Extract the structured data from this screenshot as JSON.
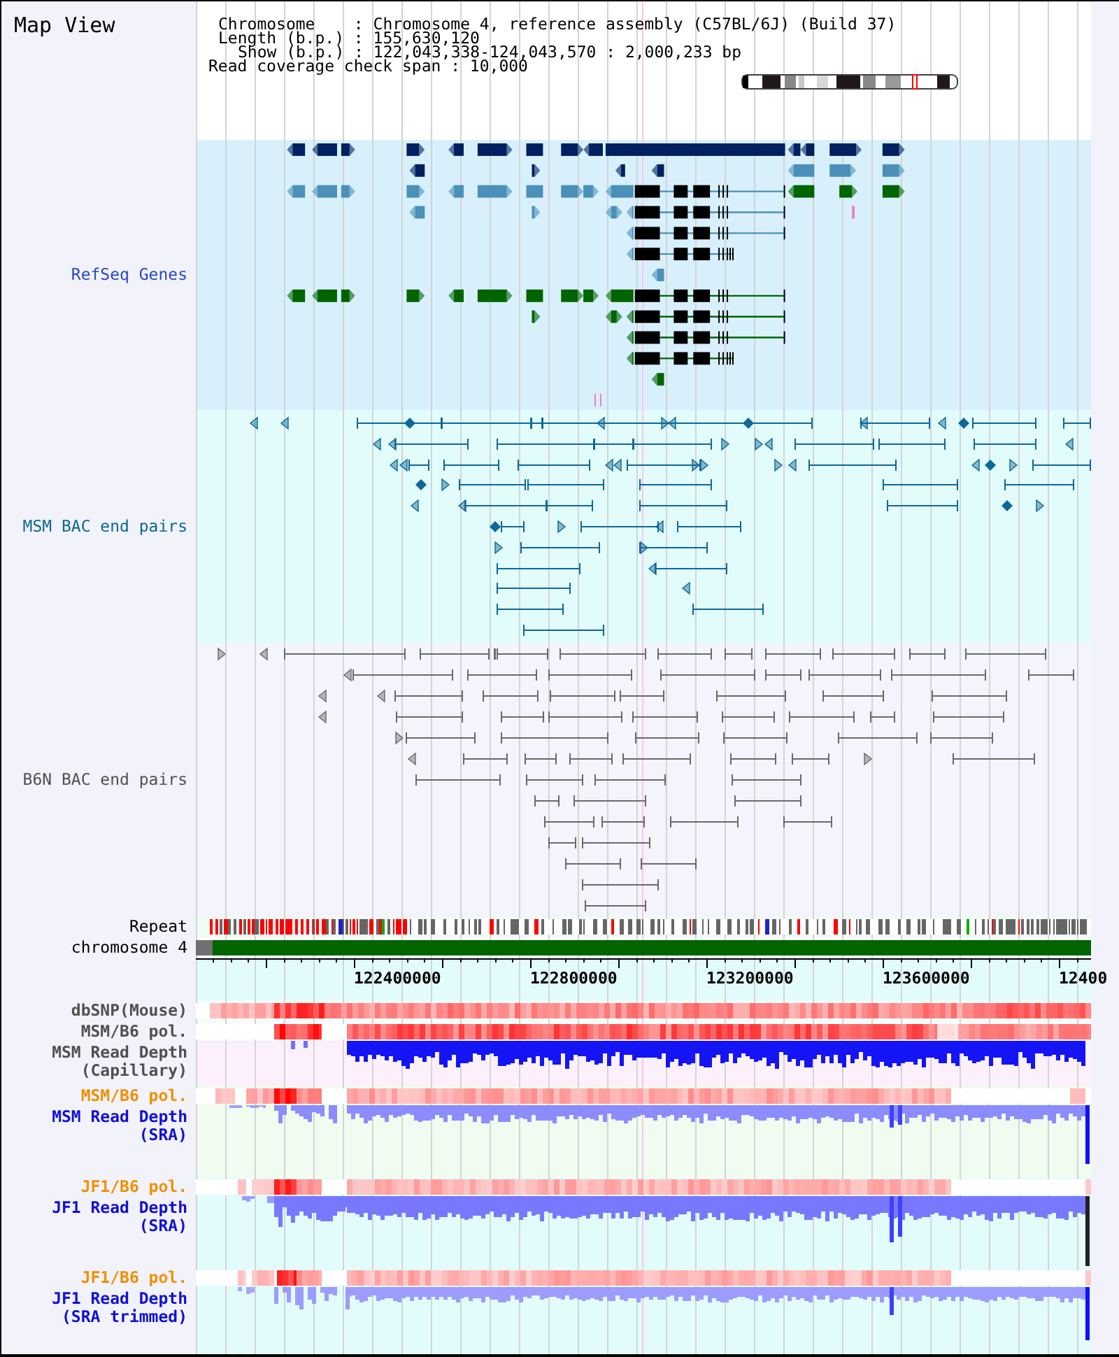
{
  "title": "Map View",
  "info": [
    "Chromosome    : Chromosome 4, reference assembly (C57BL/6J) (Build 37)",
    "Length (b.p.) : 155,630,120",
    "Show (b.p.) : 122,043,338-124,043,570 : 2,000,233 bp",
    "Read coverage check span : 10,000"
  ],
  "tracks": [
    {
      "kind": "genes",
      "label": "RefSeq Genes",
      "color": "#2848c8"
    },
    {
      "kind": "pairs",
      "label": "MSM BAC end pairs",
      "color": "#086890"
    },
    {
      "kind": "pairs",
      "label": "B6N BAC end pairs",
      "color": "#505050"
    },
    {
      "kind": "repeat",
      "label": "Repeat",
      "color": "#000000"
    },
    {
      "kind": "chromosome",
      "label": "chromosome 4",
      "color": "#000000"
    },
    {
      "kind": "axis",
      "ticks": [
        "122400000",
        "122800000",
        "123200000",
        "123600000",
        "12400"
      ]
    },
    {
      "kind": "heat",
      "label": "dbSNP(Mouse)",
      "color": "#505050"
    },
    {
      "kind": "heat",
      "label": "MSM/B6 pol.",
      "color": "#505050"
    },
    {
      "kind": "depth",
      "label": "MSM Read Depth",
      "sublabel": "(Capillary)",
      "color": "#505050"
    },
    {
      "kind": "heat",
      "label": "MSM/B6 pol.",
      "color": "#f09000"
    },
    {
      "kind": "depth",
      "label": "MSM Read Depth",
      "sublabel": "(SRA)",
      "color": "#1010d8"
    },
    {
      "kind": "heat",
      "label": "JF1/B6 pol.",
      "color": "#f09000"
    },
    {
      "kind": "depth",
      "label": "JF1 Read Depth",
      "sublabel": "(SRA)",
      "color": "#1010d8"
    },
    {
      "kind": "heat",
      "label": "JF1/B6 pol.",
      "color": "#f09000"
    },
    {
      "kind": "depth",
      "label": "JF1 Read Depth",
      "sublabel": "(SRA trimmed)",
      "color": "#1010d8"
    }
  ]
}
